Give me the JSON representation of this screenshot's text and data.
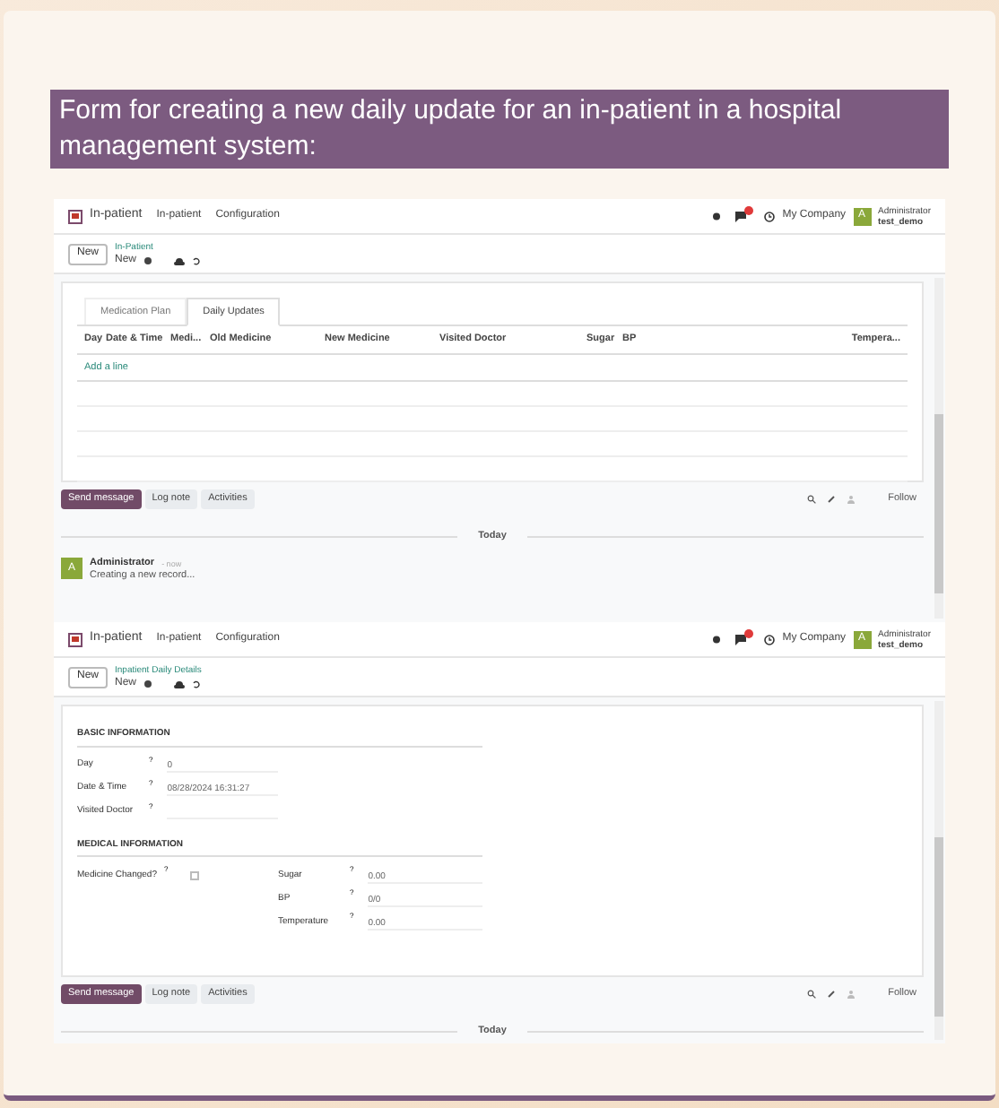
{
  "caption": "Form for creating a new daily update for an in-patient in a hospital management system:",
  "screens": [
    {
      "navbar": {
        "app": "In-patient",
        "menus": [
          "In-patient",
          "Configuration"
        ],
        "company": "My Company",
        "user": "Administrator",
        "database": "test_demo",
        "avatar": "A"
      },
      "breadcrumb": {
        "new_button": "New",
        "parent": "In-Patient",
        "current": "New"
      },
      "body": {
        "kind": "tabs",
        "tabs": [
          {
            "label": "Medication Plan",
            "selected": false
          },
          {
            "label": "Daily Updates",
            "selected": true
          }
        ],
        "columns": [
          "Day",
          "Date & Time",
          "Medi...",
          "Old Medicine",
          "New Medicine",
          "Visited Doctor",
          "Sugar",
          "BP",
          "Tempera..."
        ],
        "add_line": "Add a line"
      },
      "chatter": {
        "buttons": [
          "Send message",
          "Log note",
          "Activities"
        ],
        "follow": "Follow",
        "divider": "Today",
        "messages": [
          {
            "avatar": "A",
            "author": "Administrator",
            "time": "- now",
            "text": "Creating a new record..."
          }
        ]
      }
    },
    {
      "navbar": {
        "app": "In-patient",
        "menus": [
          "In-patient",
          "Configuration"
        ],
        "company": "My Company",
        "user": "Administrator",
        "database": "test_demo",
        "avatar": "A"
      },
      "breadcrumb": {
        "new_button": "New",
        "parent": "Inpatient Daily Details",
        "current": "New"
      },
      "body": {
        "kind": "form",
        "sections": [
          {
            "title": "BASIC INFORMATION",
            "left": [
              {
                "label": "Day",
                "help": "?",
                "value": "0"
              },
              {
                "label": "Date & Time",
                "help": "?",
                "value": "08/28/2024 16:31:27"
              },
              {
                "label": "Visited Doctor",
                "help": "?"
              }
            ]
          },
          {
            "title": "MEDICAL INFORMATION",
            "left": [
              {
                "label": "Medicine Changed?",
                "help": "?",
                "kind": "checkbox",
                "checked": false
              }
            ],
            "right": [
              {
                "label": "Sugar",
                "help": "?",
                "value": "0.00"
              },
              {
                "label": "BP",
                "help": "?",
                "value": "0/0"
              },
              {
                "label": "Temperature",
                "help": "?",
                "value": "0.00"
              }
            ]
          }
        ]
      },
      "chatter": {
        "buttons": [
          "Send message",
          "Log note",
          "Activities"
        ],
        "follow": "Follow",
        "divider": "Today"
      }
    }
  ]
}
